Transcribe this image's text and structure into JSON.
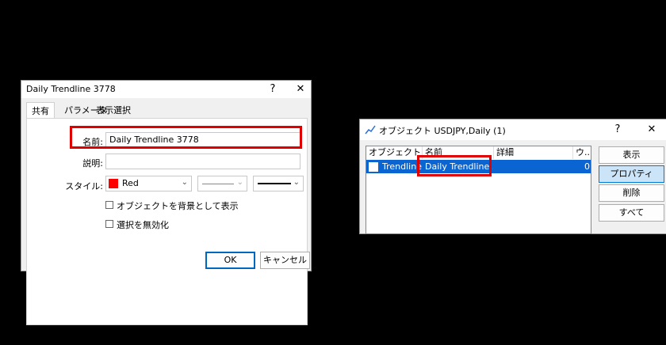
{
  "left_dialog": {
    "title": "Daily Trendline 3778",
    "help_btn": "?",
    "close_btn": "✕",
    "tabs": [
      {
        "label": "共有"
      },
      {
        "label": "パラメータ"
      },
      {
        "label": "表示選択"
      }
    ],
    "name_label": "名前:",
    "name_value": "Daily Trendline 3778",
    "desc_label": "説明:",
    "desc_value": "",
    "style_label": "スタイル:",
    "color_name": "Red",
    "color_hex": "#ff0000",
    "check_background_label": "オブジェクトを背景として表示",
    "check_disable_label": "選択を無効化",
    "ok_label": "OK",
    "cancel_label": "キャンセル"
  },
  "right_dialog": {
    "title": "オブジェクト USDJPY,Daily (1)",
    "help_btn": "?",
    "close_btn": "✕",
    "columns": [
      "オブジェクト",
      "名前",
      "詳細",
      "ウ..."
    ],
    "rows": [
      {
        "object": "Trendline",
        "name": "Daily Trendline...",
        "detail": "",
        "window": "0"
      }
    ],
    "buttons": {
      "show": "表示",
      "properties": "プロパティ",
      "delete": "削除",
      "all": "すべて"
    }
  },
  "colors": {
    "highlight": "#e00000",
    "selection": "#0a64d2"
  }
}
